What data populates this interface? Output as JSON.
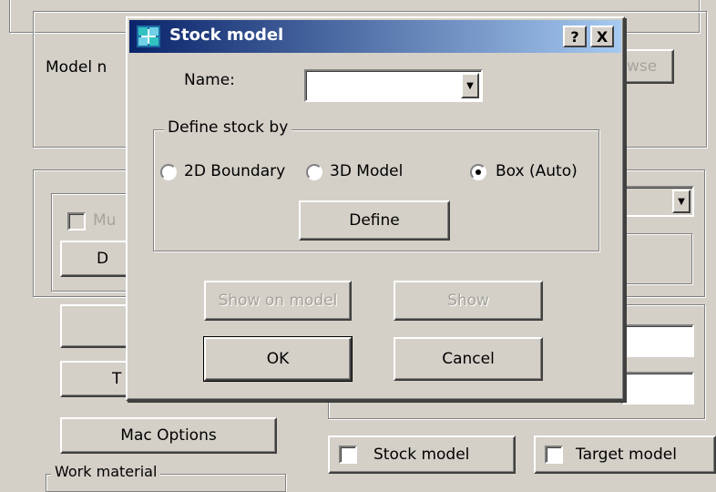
{
  "background": {
    "model_name_label": "Model n",
    "browse_label": "wse",
    "multi_label": "Mu",
    "d_button_label": "D",
    "t_button_label": "T",
    "mac_options_label": "Mac Options",
    "work_material_label": "Work material",
    "stock_model_check_label": "Stock model",
    "target_model_check_label": "Target model"
  },
  "dialog": {
    "title": "Stock model",
    "help_label": "?",
    "close_label": "X",
    "name_label": "Name:",
    "name_value": "",
    "define_group_title": "Define stock by",
    "options": [
      {
        "label": "2D Boundary",
        "selected": false
      },
      {
        "label": "3D Model",
        "selected": false
      },
      {
        "label": "Box (Auto)",
        "selected": true
      }
    ],
    "define_label": "Define",
    "show_on_model_label": "Show on model",
    "show_label": "Show",
    "ok_label": "OK",
    "cancel_label": "Cancel"
  },
  "colors": {
    "face": "#d4d0c8",
    "title_start": "#0a246a",
    "title_end": "#a6caf0"
  }
}
